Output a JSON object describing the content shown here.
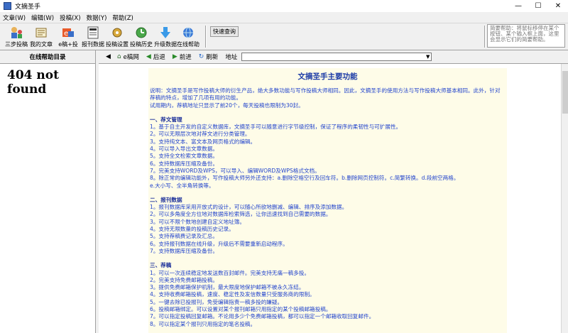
{
  "window": {
    "title": "文摘圣手"
  },
  "menu": [
    "文章(W)",
    "编辑(W)",
    "投稿(X)",
    "数据(Y)",
    "帮助(Z)"
  ],
  "toolbar": {
    "buttons": [
      {
        "label": "三步投稿",
        "icon": "wizard-icon"
      },
      {
        "label": "我的文章",
        "icon": "articles-icon"
      },
      {
        "label": "e稿+投",
        "icon": "e-submit-icon"
      },
      {
        "label": "报刊数据",
        "icon": "newspaper-data-icon"
      },
      {
        "label": "投稿设置",
        "icon": "settings-icon"
      },
      {
        "label": "投稿历史",
        "icon": "history-icon"
      },
      {
        "label": "升级数据",
        "icon": "upgrade-icon"
      },
      {
        "label": "在线帮助",
        "icon": "online-help-icon"
      }
    ],
    "quick_query": "快速查询",
    "help_text": "简要帮助：将鼠标移停在某个按钮、某个输入框上面，这里会显示它们的简要帮助。"
  },
  "left_panel": {
    "header": "在线帮助目录",
    "content": "404 not found"
  },
  "nav": {
    "ebox": "e稿网",
    "back": "后退",
    "forward": "前进",
    "refresh": "刷新",
    "address_label": "地址",
    "address_value": ""
  },
  "doc": {
    "title": "文摘圣手主要功能",
    "intro": [
      "说明：文摘圣手是写作投稿大师的衍生产品，绝大多数功能与写作投稿大师相同。因此，文摘圣手的使用方法与写作投稿大师基本相同。此外，针对荐稿的特点，增加了几项有用的功能。",
      "试用期内，荐稿地址只显示了前20个，每天投稿也限制为30封。"
    ],
    "sections": [
      {
        "heading": "一、荐文管理",
        "items": [
          "1。基于自主开发的自定义数据库，文摘圣手可以随意进行字节级控制，保证了程序的柔韧性与可扩展性。",
          "2。可以无限层次地对荐文进行分类管理。",
          "3。支持纯文本、富文本及网页格式的编辑。",
          "4。可以导入导出文章数据。",
          "5。支持全文检索文章数据。",
          "6。支持数据库压缩及备份。",
          "7。完美支持WORD及WPS，可以导入、编辑WORD及WPS格式文档。",
          "8。除正常的编辑功能外，写作投稿大师另外还支持：a.删除空格空行及回车符。b.删除网页控制符。c.简繁转换。d.段前空两格。",
          "e.大小写、全半角转换等。"
        ]
      },
      {
        "heading": "二、报刊数据",
        "items": [
          "1。报刊数据库采用开放式的设计，可以随心所欲地删减、编辑、排序及添加数据。",
          "2。可以多角度全方位地对数据库检索筛选，让你迅速找到自己需要的数据。",
          "3。可以不限个数地创建自定义地址簿。",
          "4。支持无限数量的投稿历史记录。",
          "5。支持荐稿费记录及汇总。",
          "6。支持报刊数据在线升级，升级后不需要重新启动程序。",
          "7。支持数据库压缩及备份。"
        ]
      },
      {
        "heading": "三、荐稿",
        "items": [
          "1。可以一次连续稳定地发送数百封邮件。完美支持无痛一稿多投。",
          "2。完美支持免费邮箱投稿。",
          "3。提供免费邮箱保护机制，最大限度地保护邮箱不被永久冻结。",
          "4。支持收费邮箱投稿，速度、稳定性及发信数量只受服务商的限制。",
          "5。一键去除已投报刊，免受编辑指责一稿多投的嫌疑。",
          "6。投稿邮箱绑定。可以设置对某个报刊邮箱只用指定的某个投稿邮箱投稿。",
          "7。可以指定投稿回复邮箱。不论用多少个免费邮箱投稿，都可以指定一个邮箱收取回复邮件。",
          "8。可以指定某个报刊只用指定的笔名投稿。"
        ]
      }
    ]
  }
}
